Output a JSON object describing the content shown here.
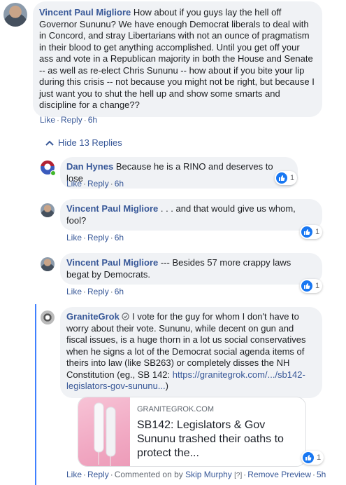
{
  "main_comment": {
    "author": "Vincent Paul Migliore",
    "text": "How about if you guys lay the hell off Governor Sununu? We have enough Democrat liberals to deal with in Concord, and stray Libertarians with not an ounce of pragmatism in their blood to get anything accomplished. Until you get off your ass and vote in a Republican majority in both the House and Senate -- as well as re-elect Chris Sununu -- how about if you bite your lip during this crisis -- not because you might not be right, but because I just want you to shut the hell up and show some smarts and discipline for a change??",
    "like": "Like",
    "reply": "Reply",
    "time": "6h"
  },
  "hide_replies": "Hide 13 Replies",
  "replies": [
    {
      "author": "Dan Hynes",
      "text": "Because he is a RINO and deserves to lose",
      "like": "Like",
      "reply": "Reply",
      "time": "6h",
      "reactions": "1"
    },
    {
      "author": "Vincent Paul Migliore",
      "text": ". . . and that would give us whom, fool?",
      "like": "Like",
      "reply": "Reply",
      "time": "6h",
      "reactions": "1"
    },
    {
      "author": "Vincent Paul Migliore",
      "text": "--- Besides 57 more crappy laws begat by Democrats.",
      "like": "Like",
      "reply": "Reply",
      "time": "6h",
      "reactions": "1"
    }
  ],
  "granite": {
    "author": "GraniteGrok",
    "text": "I vote for the guy for whom I don't have to worry about their vote. Sununu, while decent on gun and fiscal issues, is a huge thorn in a lot us social conservatives when he signs a lot of the Democrat social agenda items of theirs into law (like SB263) or completely disses the NH Constitution (eg., SB 142: ",
    "link": "https://granitegrok.com/.../sb142-legislators-gov-sununu...",
    "text_end": ")",
    "preview": {
      "domain": "GRANITEGROK.COM",
      "title": "SB142: Legislators & Gov Sununu trashed their oaths to protect the..."
    },
    "reactions": "1",
    "like": "Like",
    "reply": "Reply",
    "commented_on_by": "Commented on by",
    "commenter": "Skip Murphy",
    "help": "[?]",
    "remove_preview": "Remove Preview",
    "time": "5h"
  },
  "colors": {
    "link": "#385898",
    "bubble": "#f0f2f5",
    "like_blue": "#1877f2",
    "thread_line": "#4080ff"
  }
}
